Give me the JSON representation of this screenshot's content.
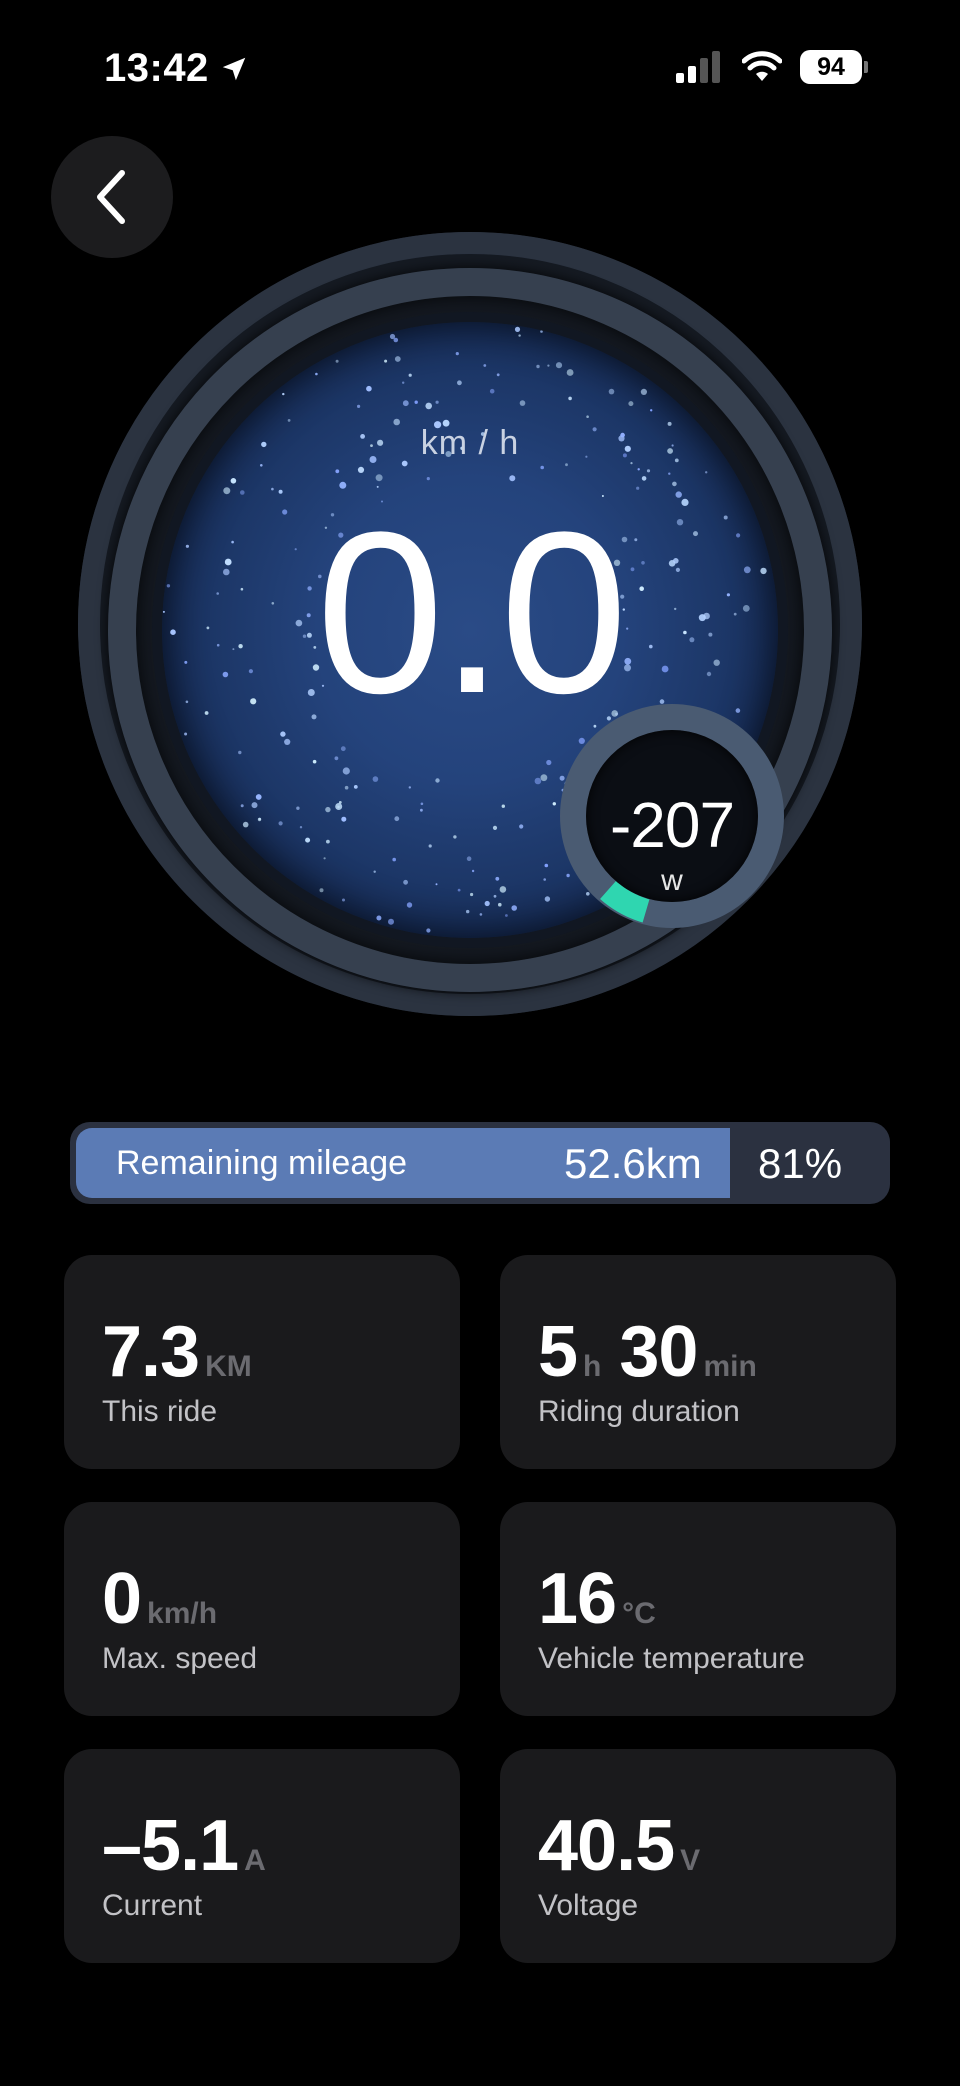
{
  "status_bar": {
    "time": "13:42",
    "battery": "94"
  },
  "speedometer": {
    "speed": "0.0",
    "unit": "km / h"
  },
  "power": {
    "value": "-207",
    "unit": "w"
  },
  "mileage": {
    "label": "Remaining mileage",
    "distance": "52.6km",
    "percent_label": "81%",
    "percent": 0.81
  },
  "stats": {
    "this_ride": {
      "value": "7.3",
      "unit": "KM",
      "label": "This ride"
    },
    "duration": {
      "hours": "5",
      "hours_unit": "h",
      "minutes": "30",
      "minutes_unit": "min",
      "label": "Riding duration"
    },
    "max_speed": {
      "value": "0",
      "unit": "km/h",
      "label": "Max. speed"
    },
    "temperature": {
      "value": "16",
      "unit": "°C",
      "label": "Vehicle temperature"
    },
    "current": {
      "value": "–5.1",
      "unit": "A",
      "label": "Current"
    },
    "voltage": {
      "value": "40.5",
      "unit": "V",
      "label": "Voltage"
    }
  },
  "colors": {
    "accent_teal": "#2fd6b0",
    "mileage_fill": "#5b7bb5",
    "card_bg": "#1a1a1c"
  }
}
